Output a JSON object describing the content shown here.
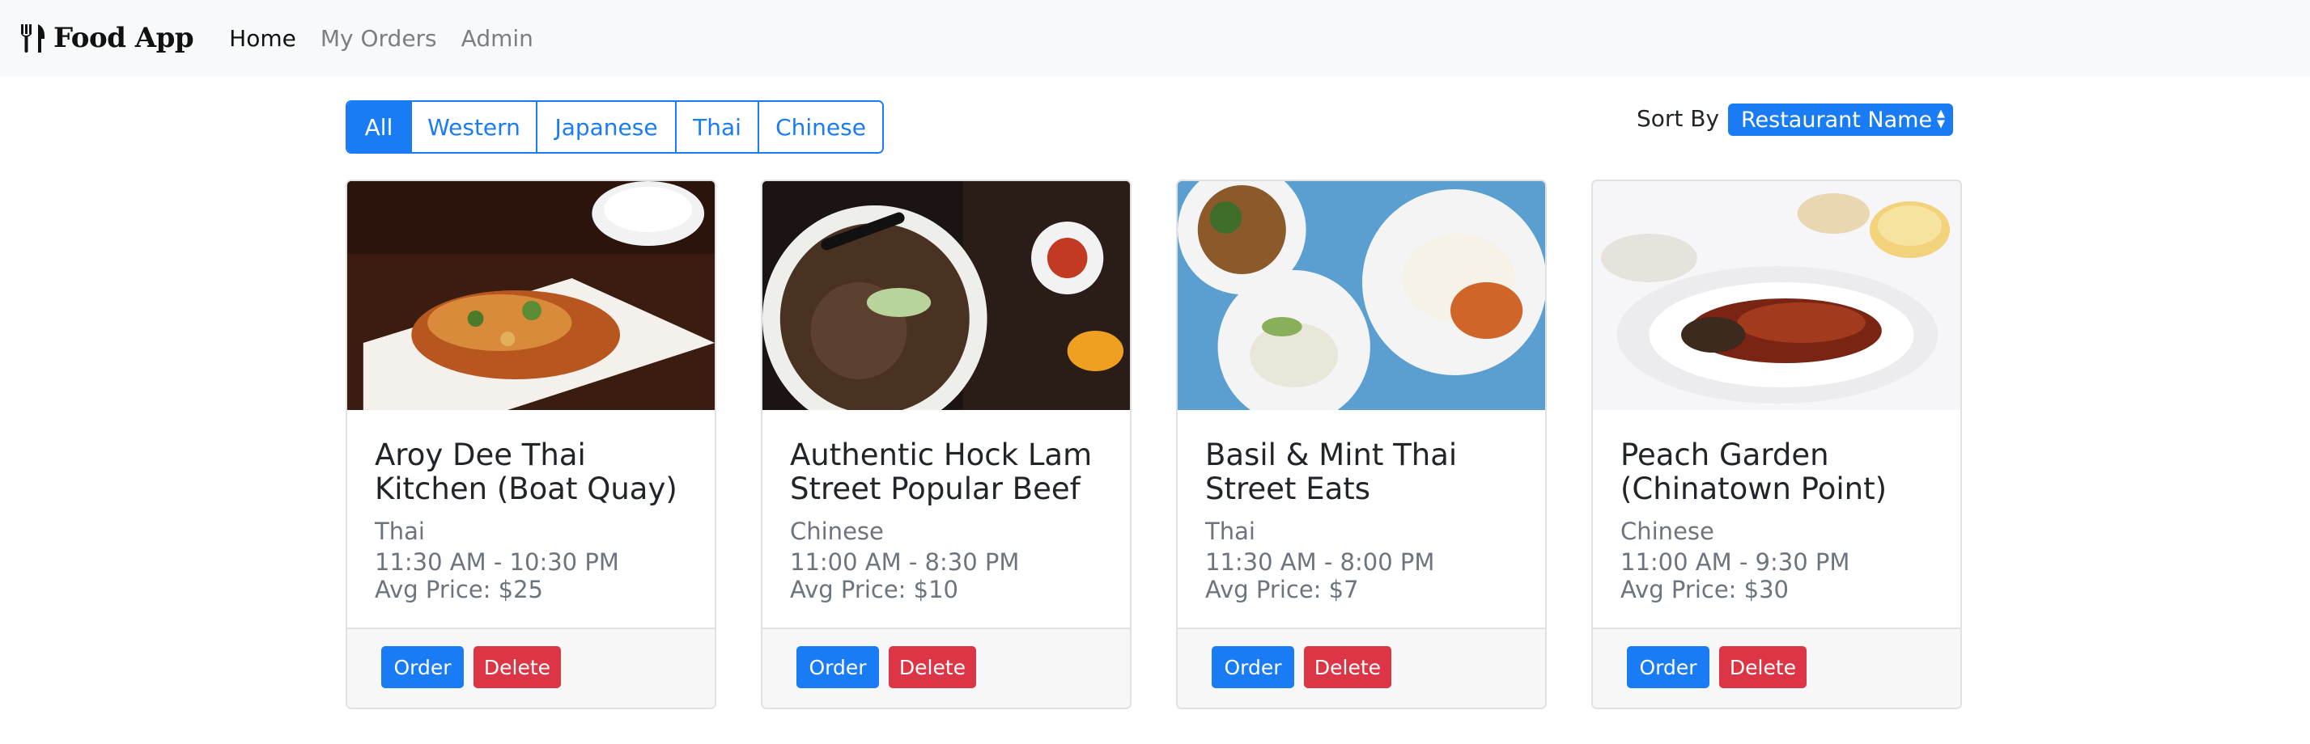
{
  "navbar": {
    "brand": "Food App",
    "links": [
      "Home",
      "My Orders",
      "Admin"
    ]
  },
  "filters": [
    "All",
    "Western",
    "Japanese",
    "Thai",
    "Chinese"
  ],
  "sort": {
    "label": "Sort By",
    "selected": "Restaurant Name"
  },
  "colors": {
    "primary": "#1a7cf5",
    "danger": "#dc3545"
  },
  "cards": [
    {
      "title": "Aroy Dee Thai Kitchen (Boat Quay)",
      "cuisine": "Thai",
      "hours": "11:30 AM - 10:30 PM",
      "price": "Avg Price: $25",
      "order": "Order",
      "delete": "Delete"
    },
    {
      "title": "Authentic Hock Lam Street Popular Beef",
      "cuisine": "Chinese",
      "hours": "11:00 AM - 8:30 PM",
      "price": "Avg Price: $10",
      "order": "Order",
      "delete": "Delete"
    },
    {
      "title": "Basil & Mint Thai Street Eats",
      "cuisine": "Thai",
      "hours": "11:30 AM - 8:00 PM",
      "price": "Avg Price: $7",
      "order": "Order",
      "delete": "Delete"
    },
    {
      "title": "Peach Garden (Chinatown Point)",
      "cuisine": "Chinese",
      "hours": "11:00 AM - 9:30 PM",
      "price": "Avg Price: $30",
      "order": "Order",
      "delete": "Delete"
    }
  ]
}
